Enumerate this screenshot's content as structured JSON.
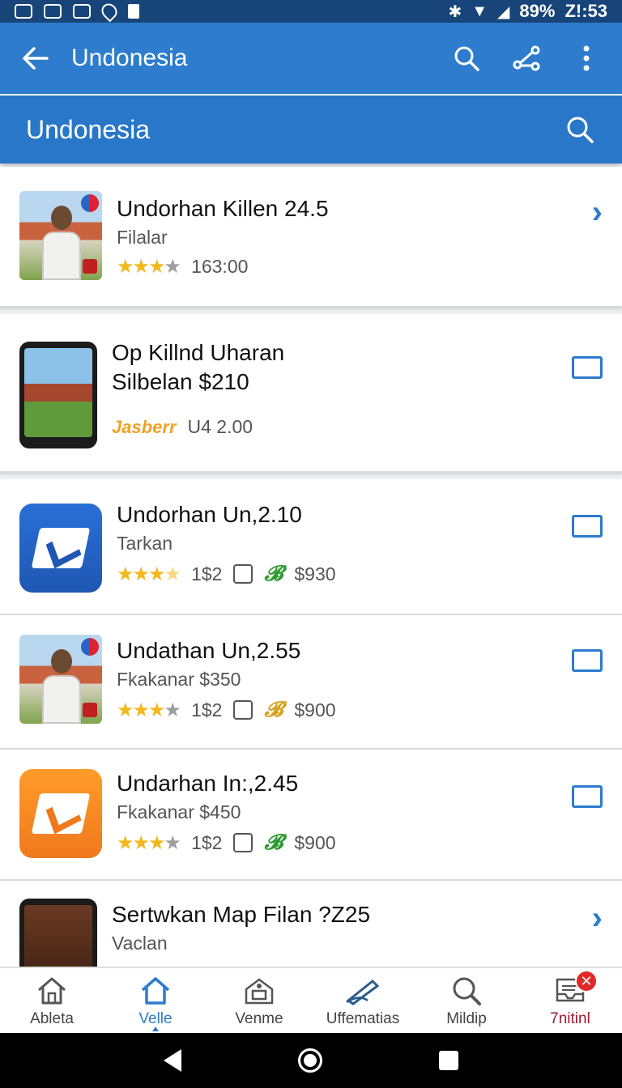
{
  "status_bar": {
    "battery": "89%",
    "time": "Z!:53"
  },
  "app_bar": {
    "title": "Undonesia",
    "icons": [
      "back-arrow-icon",
      "search-icon",
      "share-icon",
      "more-vert-icon"
    ]
  },
  "sub_header": {
    "title": "Undonesia"
  },
  "list": {
    "items": [
      {
        "name": "Undorhan Killen 24.5",
        "sub": "Filalar",
        "rating": 3,
        "extra": "163:00",
        "trailing": "chevron"
      },
      {
        "name": "Op Killnd Uharan",
        "name2": "Silbelan $210",
        "brand": "Jasberr",
        "extra": "U4 2.00",
        "trailing": "checkbox"
      },
      {
        "name": "Undorhan Un,2.10",
        "sub": "Tarkan",
        "rating": 3.5,
        "count": "1$2",
        "price": "$930",
        "trailing": "checkbox"
      },
      {
        "name": "Undathan Un,2.55",
        "sub": "Fkakanar $350",
        "rating": 3,
        "count": "1$2",
        "price": "$900",
        "trailing": "checkbox"
      },
      {
        "name": "Undarhan In:,2.45",
        "sub": "Fkakanar $450",
        "rating": 3,
        "count": "1$2",
        "price": "$900",
        "trailing": "checkbox"
      },
      {
        "name": "Sertwkan Map Filan ?Z25",
        "sub": "Vaclan",
        "trailing": "chevron"
      }
    ]
  },
  "bottom_nav": {
    "items": [
      {
        "label": "Ableta",
        "icon": "home-outline-icon"
      },
      {
        "label": "Velle",
        "icon": "home-icon",
        "active": true
      },
      {
        "label": "Venme",
        "icon": "store-icon"
      },
      {
        "label": "Uffematias",
        "icon": "pen-icon"
      },
      {
        "label": "Mildip",
        "icon": "search-icon"
      },
      {
        "label": "7nitinl",
        "icon": "inbox-icon",
        "badge": "✕"
      }
    ]
  },
  "colors": {
    "primary": "#2d7ccd",
    "status_bar": "#17457a",
    "star": "#f2b81d",
    "badge": "#e02a2a"
  }
}
